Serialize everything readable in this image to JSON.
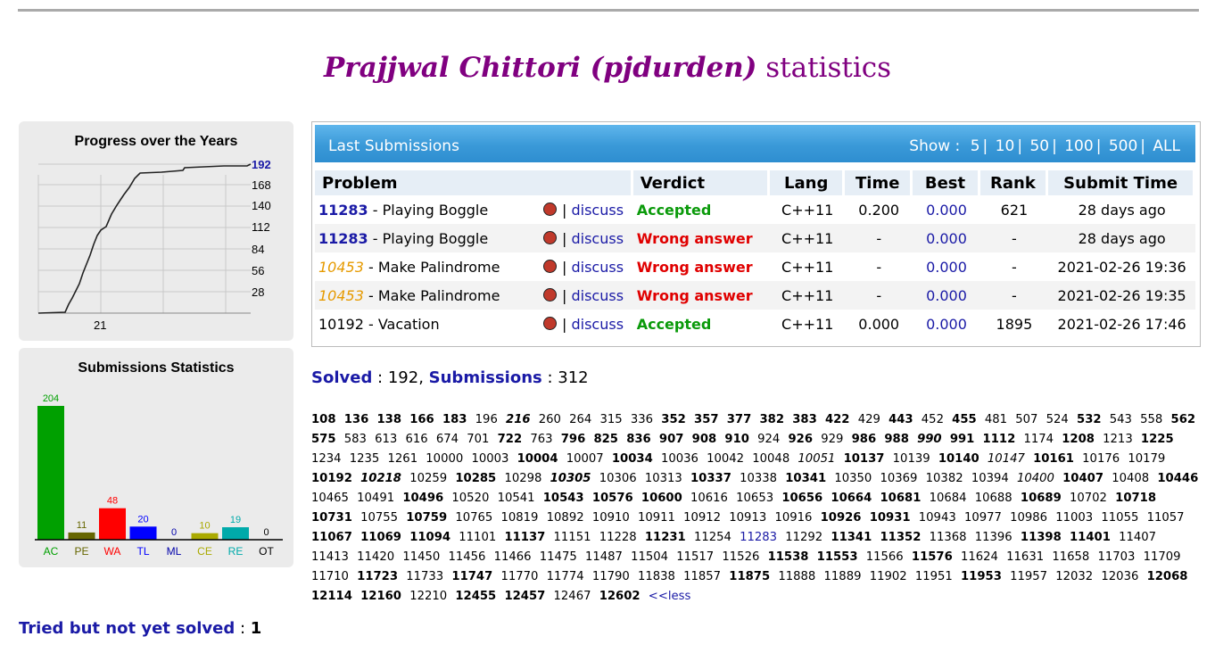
{
  "page": {
    "title_name": "Prajjwal Chittori (pjdurden)",
    "title_suffix": "statistics"
  },
  "progress": {
    "title": "Progress over the Years",
    "yticks": [
      "192",
      "168",
      "140",
      "112",
      "84",
      "56",
      "28"
    ],
    "xtick": "21"
  },
  "submission_stats": {
    "title": "Submissions Statistics",
    "bars": [
      {
        "label": "AC",
        "value": 204,
        "color": "#00a000"
      },
      {
        "label": "PE",
        "value": 11,
        "color": "#666600"
      },
      {
        "label": "WA",
        "value": 48,
        "color": "#ff0000"
      },
      {
        "label": "TL",
        "value": 20,
        "color": "#0000ff"
      },
      {
        "label": "ML",
        "value": 0,
        "color": "#0000aa"
      },
      {
        "label": "CE",
        "value": 10,
        "color": "#aaaa00"
      },
      {
        "label": "RE",
        "value": 19,
        "color": "#00aaaa"
      },
      {
        "label": "OT",
        "value": 0,
        "color": "#000000"
      }
    ]
  },
  "last_submissions": {
    "label": "Last Submissions",
    "show_label": "Show :",
    "show_options": [
      "5",
      "10",
      "50",
      "100",
      "500",
      "ALL"
    ],
    "columns": [
      "Problem",
      "Verdict",
      "Lang",
      "Time",
      "Best",
      "Rank",
      "Submit Time"
    ],
    "rows": [
      {
        "id": "11283",
        "name": " - Playing Boggle",
        "style": "solved",
        "discuss": "discuss",
        "verdict": "Accepted",
        "verdict_type": "ok",
        "lang": "C++11",
        "time": "0.200",
        "best": "0.000",
        "rank": "621",
        "submit": "28 days ago"
      },
      {
        "id": "11283",
        "name": " - Playing Boggle",
        "style": "solved",
        "discuss": "discuss",
        "verdict": "Wrong answer",
        "verdict_type": "wa",
        "lang": "C++11",
        "time": "-",
        "best": "0.000",
        "rank": "-",
        "submit": "28 days ago"
      },
      {
        "id": "10453",
        "name": " - Make Palindrome",
        "style": "tried",
        "discuss": "discuss",
        "verdict": "Wrong answer",
        "verdict_type": "wa",
        "lang": "C++11",
        "time": "-",
        "best": "0.000",
        "rank": "-",
        "submit": "2021-02-26 19:36"
      },
      {
        "id": "10453",
        "name": " - Make Palindrome",
        "style": "tried",
        "discuss": "discuss",
        "verdict": "Wrong answer",
        "verdict_type": "wa",
        "lang": "C++11",
        "time": "-",
        "best": "0.000",
        "rank": "-",
        "submit": "2021-02-26 19:35"
      },
      {
        "id": "10192",
        "name": " - Vacation",
        "style": "plain",
        "discuss": "discuss",
        "verdict": "Accepted",
        "verdict_type": "ok",
        "lang": "C++11",
        "time": "0.000",
        "best": "0.000",
        "rank": "1895",
        "submit": "2021-02-26 17:46"
      }
    ]
  },
  "summary": {
    "solved_label": "Solved",
    "solved_value": "192",
    "submissions_label": "Submissions",
    "submissions_value": "312"
  },
  "problem_list": "108* 136* 138* 166* 183* 196 216~ 260 264 315 336 352* 357* 377* 382* 383* 422* 429 443* 452 455* 481 507 524 532* 543 558 562* 575* 583 613 616 674 701 722* 763 796* 825* 836* 907* 908* 910* 924 926* 929 986* 988* 990~ 991* 1112* 1174 1208* 1213 1225* 1234 1235 1261 10000 10003 10004* 10007 10034* 10036 10042 10048 10051^ 10137* 10139 10140* 10147^ 10161* 10176 10179 10192* 10218~ 10259 10285* 10298 10305~ 10306 10313 10337* 10338 10341* 10350 10369 10382 10394 10400^ 10407* 10408 10446* 10465 10491 10496* 10520 10541 10543* 10576* 10600* 10616 10653 10656* 10664* 10681* 10684 10688 10689* 10702 10718* 10731* 10755 10759* 10765 10819 10892 10910 10911 10912 10913 10916 10926* 10931* 10943 10977 10986 11003 11055 11057 11067* 11069* 11094* 11101 11137* 11151 11228 11231* 11254 11283# 11292 11341* 11352* 11368 11396 11398* 11401* 11407 11413 11420 11450 11456 11466 11475 11487 11504 11517 11526 11538* 11553* 11566 11576* 11624 11631 11658 11703 11709 11710 11723* 11733 11747* 11770 11774 11790 11838 11857 11875* 11888 11889 11902 11951 11953* 11957 12032 12036 12068* 12114* 12160* 12210 12455* 12457* 12467 12602*",
  "less_link": "<<less",
  "tried": {
    "label": "Tried but not yet solved",
    "value": "1"
  }
}
